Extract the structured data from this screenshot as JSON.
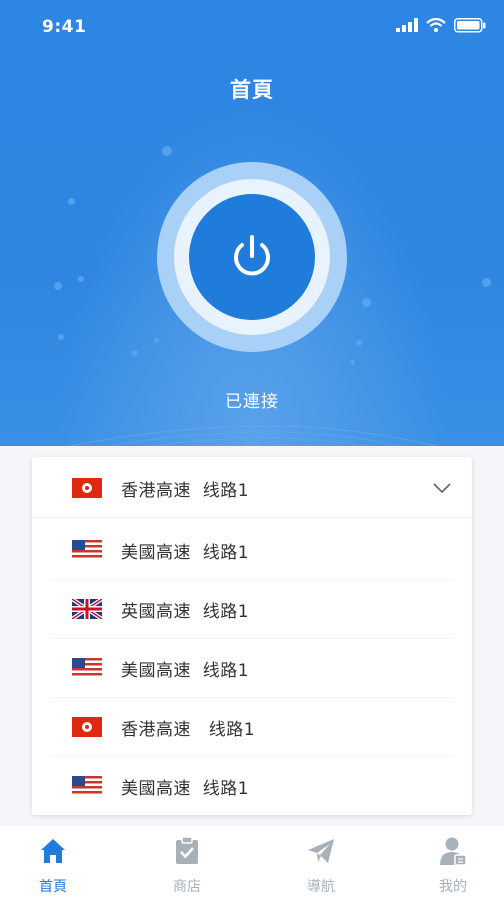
{
  "status_bar": {
    "time": "9:41"
  },
  "header": {
    "title": "首頁"
  },
  "connection": {
    "status_label": "已連接"
  },
  "server_select": {
    "selected": {
      "flag": "hong-kong-flag",
      "label": "香港高速  线路1"
    },
    "options": [
      {
        "flag": "usa-flag",
        "label": "美國高速  线路1"
      },
      {
        "flag": "uk-flag",
        "label": "英國高速  线路1"
      },
      {
        "flag": "usa-flag",
        "label": "美國高速  线路1"
      },
      {
        "flag": "hong-kong-flag",
        "label": "香港高速   线路1"
      },
      {
        "flag": "usa-flag",
        "label": "美國高速  线路1"
      }
    ]
  },
  "tabbar": {
    "tabs": [
      {
        "label": "首頁",
        "icon": "home-icon",
        "active": true
      },
      {
        "label": "商店",
        "icon": "clipboard-icon",
        "active": false
      },
      {
        "label": "導航",
        "icon": "paper-plane-icon",
        "active": false
      },
      {
        "label": "我的",
        "icon": "user-icon",
        "active": false
      }
    ]
  },
  "colors": {
    "primary": "#1f7cdb",
    "hero": "#2f86e0",
    "inactive": "#a8b0ba"
  }
}
